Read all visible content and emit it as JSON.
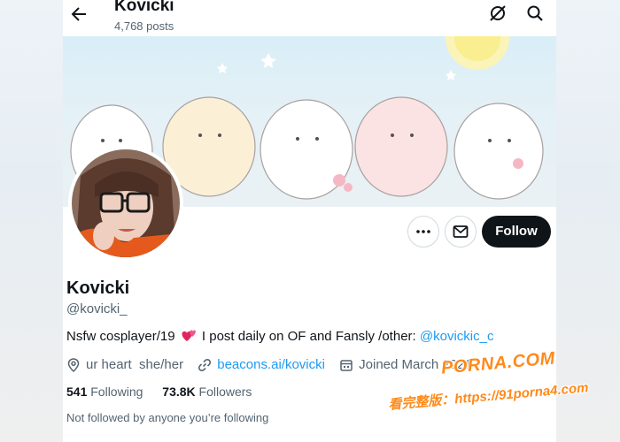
{
  "header": {
    "name": "Kovicki",
    "post_count": "4,768 posts",
    "back_icon": "arrow-left-icon",
    "grok_icon": "grok-icon",
    "search_icon": "search-icon"
  },
  "banner": {
    "description_icon": "kawaii-cats-banner"
  },
  "actions": {
    "more_icon": "more-dots-icon",
    "message_icon": "envelope-icon",
    "follow_label": "Follow"
  },
  "profile": {
    "display_name": "Kovicki",
    "handle": "@kovicki_",
    "bio_text": "Nsfw cosplayer/19",
    "bio_text_2": "I post daily on OF and Fansly /other:",
    "bio_mention": "@kovickic_c",
    "location": "ur heart  she/her",
    "website": "beacons.ai/kovicki",
    "joined": "Joined March 2021",
    "following_count": "541",
    "following_label": "Following",
    "followers_count": "73.8K",
    "followers_label": "Followers",
    "not_followed": "Not followed by anyone you’re following"
  },
  "watermark": {
    "line1": "PORNA.COM",
    "line2": "看完整版：https://91porna4.com"
  },
  "colors": {
    "accent": "#1d9bf0",
    "text": "#0f1419",
    "muted": "#536471",
    "follow_bg": "#0f1419",
    "watermark": "#ff8a1a"
  }
}
